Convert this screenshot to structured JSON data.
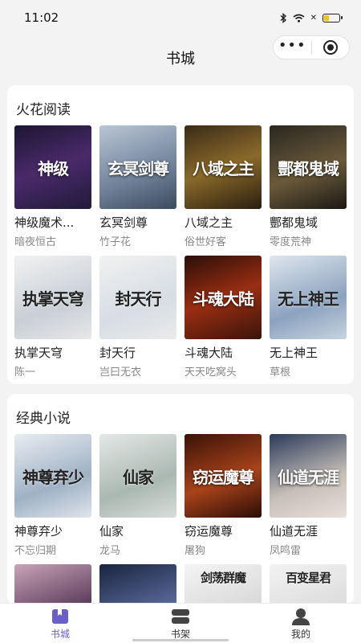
{
  "status": {
    "time": "11:02",
    "battery_level": 0.35
  },
  "nav": {
    "title": "书城"
  },
  "sections": [
    {
      "title": "火花阅读",
      "books": [
        {
          "name": "神级魔术...",
          "author": "暗夜恒古",
          "cover_text": "神级",
          "cover_bg": "linear-gradient(160deg,#1c1633,#4a2a6a 50%,#201a3a)"
        },
        {
          "name": "玄冥剑尊",
          "author": "竹子花",
          "cover_text": "玄冥剑尊",
          "cover_bg": "linear-gradient(160deg,#b9c6d6,#6f8098 60%,#3c4a5e)"
        },
        {
          "name": "八域之主",
          "author": "俗世好客",
          "cover_text": "八域之主",
          "cover_bg": "linear-gradient(160deg,#3a2a18,#8a6a2a 50%,#2a1e10)"
        },
        {
          "name": "酆都鬼域",
          "author": "零度荒神",
          "cover_text": "酆都鬼域",
          "cover_bg": "linear-gradient(160deg,#2a2620,#6a5a3a 55%,#1a1814)"
        },
        {
          "name": "执掌天穹",
          "author": "陈一",
          "cover_text": "执掌天穹",
          "cover_bg": "linear-gradient(160deg,#f2f2f2,#c9cfd6 60%,#e7e7e7)",
          "light": true
        },
        {
          "name": "封天行",
          "author": "岂曰无衣",
          "cover_text": "封天行",
          "cover_bg": "linear-gradient(160deg,#f1f1f1,#d7dde3 60%,#eaeaea)",
          "light": true
        },
        {
          "name": "斗魂大陆",
          "author": "天天吃窝头",
          "cover_text": "斗魂大陆",
          "cover_bg": "linear-gradient(160deg,#2a0e08,#9a2e12 50%,#3a140a)"
        },
        {
          "name": "无上神王",
          "author": "草根",
          "cover_text": "无上神王",
          "cover_bg": "linear-gradient(160deg,#dfe6ee,#8ba3bf 60%,#c8d3df)",
          "light": true
        }
      ]
    },
    {
      "title": "经典小说",
      "books": [
        {
          "name": "神尊弃少",
          "author": "不忘归期",
          "cover_text": "神尊弃少",
          "cover_bg": "linear-gradient(160deg,#e8edf2,#9fb1c4 60%,#dfe5ec)",
          "light": true
        },
        {
          "name": "仙家",
          "author": "龙马",
          "cover_text": "仙家",
          "cover_bg": "linear-gradient(160deg,#e4e8e6,#aab8b2 60%,#d8dedb)",
          "light": true
        },
        {
          "name": "窃运魔尊",
          "author": "屠狗",
          "cover_text": "窃运魔尊",
          "cover_bg": "linear-gradient(160deg,#3a1208,#a8431a 55%,#2a0c06)"
        },
        {
          "name": "仙道无涯",
          "author": "凤鸣雷",
          "cover_text": "仙道无涯",
          "cover_bg": "linear-gradient(160deg,#2a3a5a,#c8c0b8 60%,#e8e0d8)"
        }
      ],
      "partial_books": [
        {
          "cover_text": "",
          "cover_bg": "linear-gradient(160deg,#c9a4b8,#5a3a5a)"
        },
        {
          "cover_text": "",
          "cover_bg": "linear-gradient(160deg,#1a2440,#5a6a9a)"
        },
        {
          "cover_text": "剑荡群魔",
          "cover_bg": "linear-gradient(160deg,#f4f4f4,#d8d8d8)",
          "light": true
        },
        {
          "cover_text": "百变星君",
          "cover_bg": "linear-gradient(160deg,#f2f2f2,#dcdcdc)",
          "light": true
        }
      ]
    }
  ],
  "tabs": [
    {
      "label": "书城",
      "icon": "book-icon",
      "active": true
    },
    {
      "label": "书架",
      "icon": "bookshelf-icon",
      "active": false
    },
    {
      "label": "我的",
      "icon": "user-icon",
      "active": false
    }
  ],
  "colors": {
    "accent": "#6a5ec8",
    "background": "#f3f3f3"
  }
}
